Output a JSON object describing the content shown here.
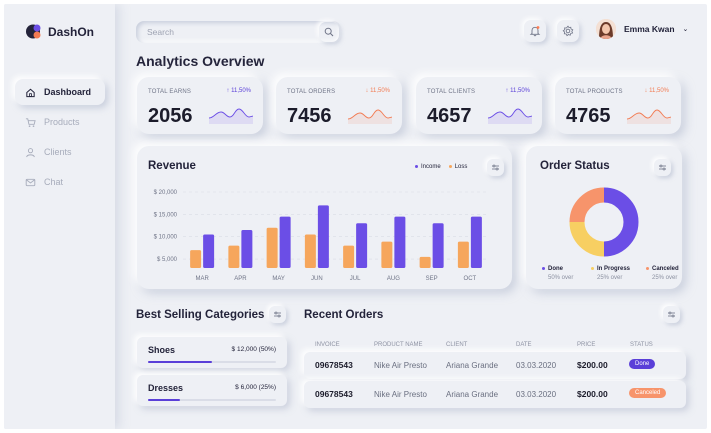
{
  "app": {
    "name": "DashOn"
  },
  "sidebar": {
    "items": [
      {
        "label": "Dashboard",
        "icon": "home-icon",
        "active": true
      },
      {
        "label": "Products",
        "icon": "cart-icon",
        "active": false
      },
      {
        "label": "Clients",
        "icon": "user-icon",
        "active": false
      },
      {
        "label": "Chat",
        "icon": "mail-icon",
        "active": false
      }
    ]
  },
  "header": {
    "search_placeholder": "Search",
    "user_name": "Emma Kwan",
    "notification_color": "#ff7a50"
  },
  "page": {
    "title": "Analytics Overview"
  },
  "stats": [
    {
      "label": "TOTAL EARNS",
      "value": "2056",
      "trend": "↑ 11,50%",
      "direction": "up"
    },
    {
      "label": "TOTAL ORDERS",
      "value": "7456",
      "trend": "↓ 11,50%",
      "direction": "down"
    },
    {
      "label": "TOTAL CLIENTS",
      "value": "4657",
      "trend": "↑ 11,50%",
      "direction": "up"
    },
    {
      "label": "TOTAL PRODUCTS",
      "value": "4765",
      "trend": "↓ 11,50%",
      "direction": "down"
    }
  ],
  "colors": {
    "accent": "#5a3fd8",
    "income": "#6b4ee6",
    "loss": "#f6a65c",
    "down": "#f27b52",
    "in_progress": "#f7cf62",
    "canceled": "#f7946b"
  },
  "revenue": {
    "title": "Revenue",
    "legend": {
      "income": "Income",
      "loss": "Loss"
    }
  },
  "chart_data": {
    "type": "bar",
    "title": "Revenue",
    "categories": [
      "MAR",
      "APR",
      "MAY",
      "JUN",
      "JUL",
      "AUG",
      "SEP",
      "OCT"
    ],
    "y_tick_labels": [
      "$ 20,000",
      "$ 15,000",
      "$ 10,000",
      "$ 5,000"
    ],
    "ylim": [
      3000,
      20000
    ],
    "series": [
      {
        "name": "Income",
        "values": [
          10500,
          11500,
          14500,
          17000,
          13000,
          14500,
          13000,
          14500
        ]
      },
      {
        "name": "Loss",
        "values": [
          7000,
          8000,
          12000,
          10500,
          8000,
          8900,
          5500,
          8900
        ]
      }
    ],
    "legend_position": "top-right",
    "grid": true
  },
  "order_status": {
    "title": "Order Status",
    "segments": [
      {
        "label": "Done",
        "sub": "50% over",
        "value": 50,
        "color": "#6b4ee6"
      },
      {
        "label": "In Progress",
        "sub": "25% over",
        "value": 25,
        "color": "#f7cf62"
      },
      {
        "label": "Canceled",
        "sub": "25% over",
        "value": 25,
        "color": "#f7946b"
      }
    ]
  },
  "best_selling": {
    "title": "Best Selling Categories",
    "items": [
      {
        "name": "Shoes",
        "value": "$ 12,000 (50%)",
        "fraction": 0.5
      },
      {
        "name": "Dresses",
        "value": "$ 6,000 (25%)",
        "fraction": 0.25
      }
    ]
  },
  "recent_orders": {
    "title": "Recent Orders",
    "headers": [
      "INVOICE",
      "PRODUCT NAME",
      "CLIENT",
      "DATE",
      "PRICE",
      "STATUS"
    ],
    "rows": [
      {
        "invoice": "09678543",
        "product": "Nike Air Presto",
        "client": "Ariana Grande",
        "date": "03.03.2020",
        "price": "$200.00",
        "status": "Done",
        "status_color": "#5a3fd8"
      },
      {
        "invoice": "09678543",
        "product": "Nike Air Presto",
        "client": "Ariana Grande",
        "date": "03.03.2020",
        "price": "$200.00",
        "status": "Canceled",
        "status_color": "#f7946b"
      }
    ]
  }
}
